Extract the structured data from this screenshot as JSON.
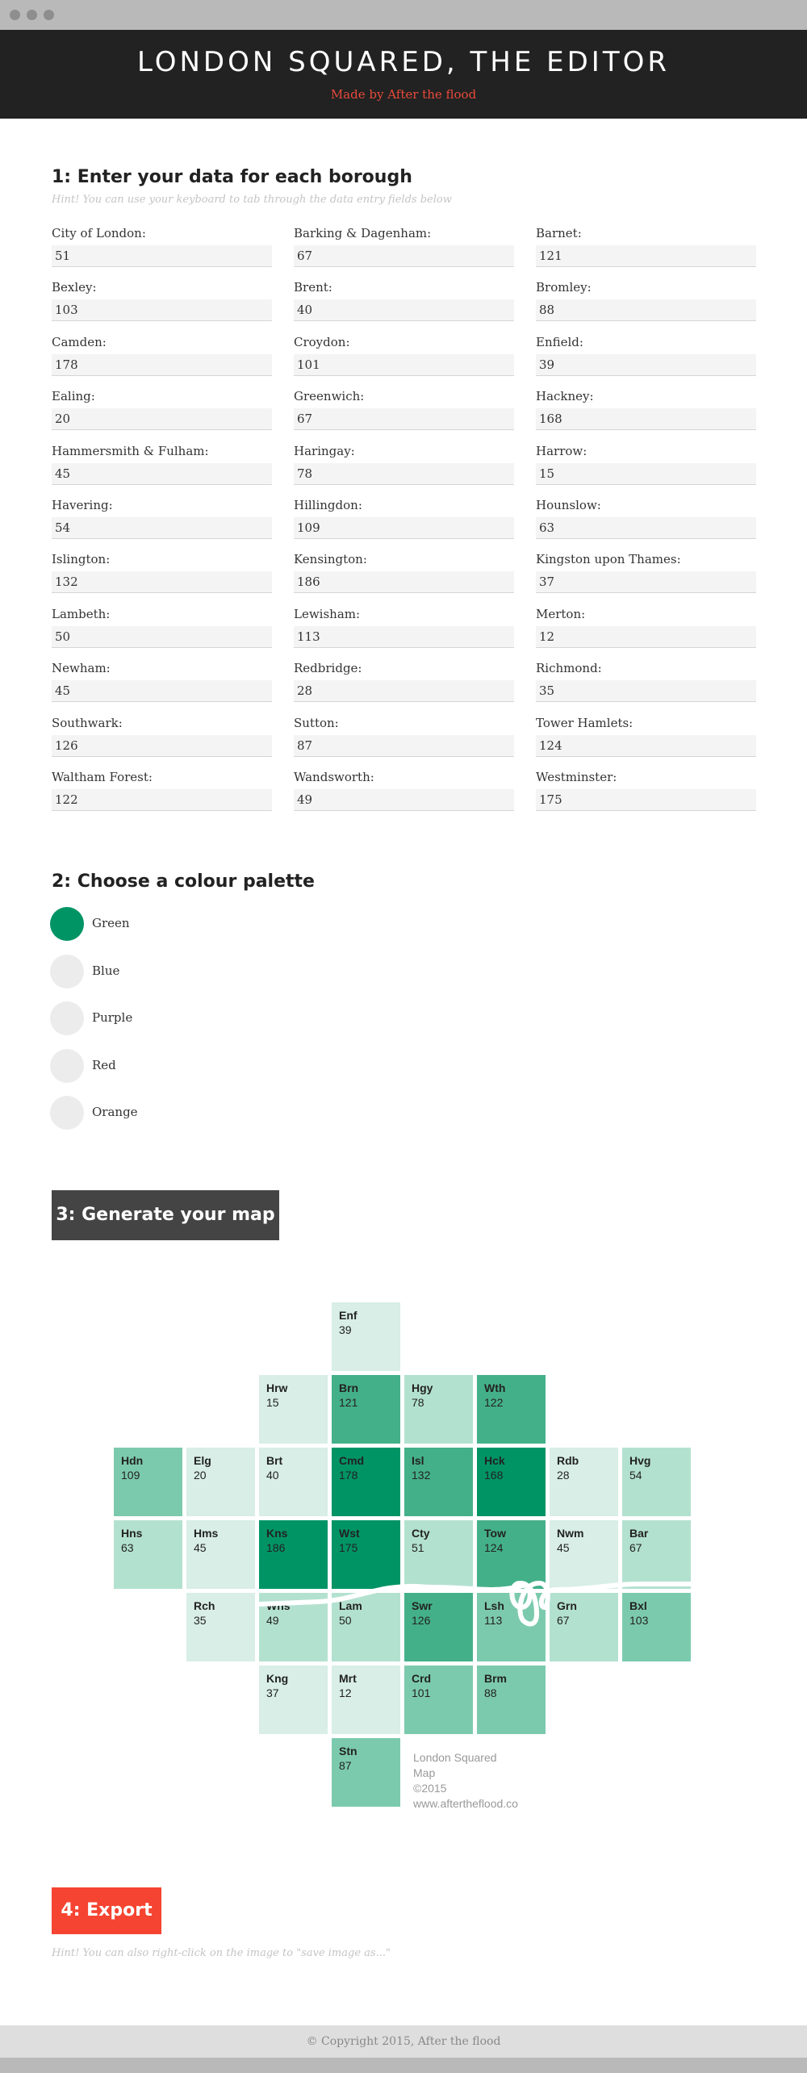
{
  "header": {
    "title": "LONDON SQUARED, THE EDITOR",
    "byline": "Made by After the flood"
  },
  "step1": {
    "title": "1: Enter your data for each borough",
    "hint": "Hint! You can use your keyboard to tab through the data entry fields below",
    "fields": [
      {
        "label": "City of London:",
        "value": "51"
      },
      {
        "label": "Barking & Dagenham:",
        "value": "67"
      },
      {
        "label": "Barnet:",
        "value": "121"
      },
      {
        "label": "Bexley:",
        "value": "103"
      },
      {
        "label": "Brent:",
        "value": "40"
      },
      {
        "label": "Bromley:",
        "value": "88"
      },
      {
        "label": "Camden:",
        "value": "178"
      },
      {
        "label": "Croydon:",
        "value": "101"
      },
      {
        "label": "Enfield:",
        "value": "39"
      },
      {
        "label": "Ealing:",
        "value": "20"
      },
      {
        "label": "Greenwich:",
        "value": "67"
      },
      {
        "label": "Hackney:",
        "value": "168"
      },
      {
        "label": "Hammersmith & Fulham:",
        "value": "45"
      },
      {
        "label": "Haringay:",
        "value": "78"
      },
      {
        "label": "Harrow:",
        "value": "15"
      },
      {
        "label": "Havering:",
        "value": "54"
      },
      {
        "label": "Hillingdon:",
        "value": "109"
      },
      {
        "label": "Hounslow:",
        "value": "63"
      },
      {
        "label": "Islington:",
        "value": "132"
      },
      {
        "label": "Kensington:",
        "value": "186"
      },
      {
        "label": "Kingston upon Thames:",
        "value": "37"
      },
      {
        "label": "Lambeth:",
        "value": "50"
      },
      {
        "label": "Lewisham:",
        "value": "113"
      },
      {
        "label": "Merton:",
        "value": "12"
      },
      {
        "label": "Newham:",
        "value": "45"
      },
      {
        "label": "Redbridge:",
        "value": "28"
      },
      {
        "label": "Richmond:",
        "value": "35"
      },
      {
        "label": "Southwark:",
        "value": "126"
      },
      {
        "label": "Sutton:",
        "value": "87"
      },
      {
        "label": "Tower Hamlets:",
        "value": "124"
      },
      {
        "label": "Waltham Forest:",
        "value": "122"
      },
      {
        "label": "Wandsworth:",
        "value": "49"
      },
      {
        "label": "Westminster:",
        "value": "175"
      }
    ]
  },
  "step2": {
    "title": "2: Choose a colour palette",
    "options": [
      {
        "label": "Green",
        "selected": true
      },
      {
        "label": "Blue",
        "selected": false
      },
      {
        "label": "Purple",
        "selected": false
      },
      {
        "label": "Red",
        "selected": false
      },
      {
        "label": "Orange",
        "selected": false
      }
    ],
    "selected_color": "#009465"
  },
  "step3": {
    "button_label": "3: Generate your map"
  },
  "map": {
    "tiles": [
      {
        "code": "Enf",
        "value": "39"
      },
      {
        "code": "Hrw",
        "value": "15"
      },
      {
        "code": "Brn",
        "value": "121"
      },
      {
        "code": "Hgy",
        "value": "78"
      },
      {
        "code": "Wth",
        "value": "122"
      },
      {
        "code": "Hdn",
        "value": "109"
      },
      {
        "code": "Elg",
        "value": "20"
      },
      {
        "code": "Brt",
        "value": "40"
      },
      {
        "code": "Cmd",
        "value": "178"
      },
      {
        "code": "Isl",
        "value": "132"
      },
      {
        "code": "Hck",
        "value": "168"
      },
      {
        "code": "Rdb",
        "value": "28"
      },
      {
        "code": "Hvg",
        "value": "54"
      },
      {
        "code": "Hns",
        "value": "63"
      },
      {
        "code": "Hms",
        "value": "45"
      },
      {
        "code": "Kns",
        "value": "186"
      },
      {
        "code": "Wst",
        "value": "175"
      },
      {
        "code": "Cty",
        "value": "51"
      },
      {
        "code": "Tow",
        "value": "124"
      },
      {
        "code": "Nwm",
        "value": "45"
      },
      {
        "code": "Bar",
        "value": "67"
      },
      {
        "code": "Rch",
        "value": "35"
      },
      {
        "code": "Wns",
        "value": "49"
      },
      {
        "code": "Lam",
        "value": "50"
      },
      {
        "code": "Swr",
        "value": "126"
      },
      {
        "code": "Lsh",
        "value": "113"
      },
      {
        "code": "Grn",
        "value": "67"
      },
      {
        "code": "Bxl",
        "value": "103"
      },
      {
        "code": "Kng",
        "value": "37"
      },
      {
        "code": "Mrt",
        "value": "12"
      },
      {
        "code": "Crd",
        "value": "101"
      },
      {
        "code": "Brm",
        "value": "88"
      },
      {
        "code": "Stn",
        "value": "87"
      }
    ],
    "credit_line1": "London Squared Map",
    "credit_line2": "©2015 www.aftertheflood.co"
  },
  "step4": {
    "button_label": "4: Export",
    "hint": "Hint! You can also right-click on the image to \"save image as...\""
  },
  "footer": {
    "copyright": "© Copyright 2015, After the flood"
  }
}
